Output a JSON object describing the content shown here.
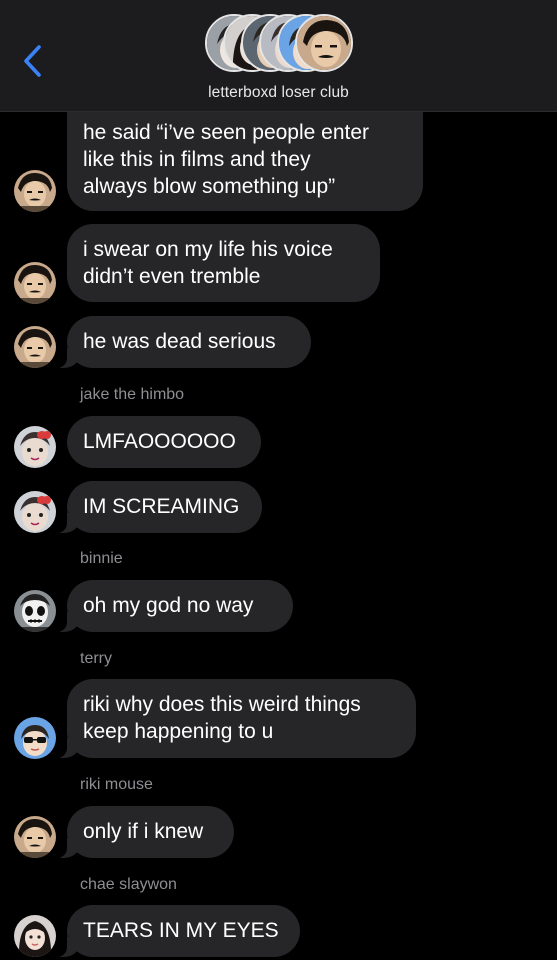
{
  "header": {
    "title": "letterboxd loser club",
    "back_icon": "chevron-left-icon",
    "accent_color": "#3a82f7"
  },
  "messages": [
    {
      "sender": "",
      "text": "he said “i’ve seen people enter\nlike this in films and they\nalways blow something up”",
      "avatar": "riki"
    },
    {
      "sender": "",
      "text": "i swear on my life his voice\ndidn’t even tremble",
      "avatar": "riki"
    },
    {
      "sender": "",
      "text": "he was dead serious",
      "avatar": "riki"
    },
    {
      "sender": "jake the himbo",
      "text": "LMFAOOOOOO",
      "avatar": "jake"
    },
    {
      "sender": "",
      "text": "IM SCREAMING",
      "avatar": "jake"
    },
    {
      "sender": "binnie",
      "text": "oh my god no way",
      "avatar": "binnie"
    },
    {
      "sender": "terry",
      "text": "riki why does this weird things\nkeep happening to u",
      "avatar": "terry"
    },
    {
      "sender": "riki mouse",
      "text": "only if i knew",
      "avatar": "riki"
    },
    {
      "sender": "chae slaywon",
      "text": "TEARS IN MY EYES",
      "avatar": "chae"
    }
  ]
}
